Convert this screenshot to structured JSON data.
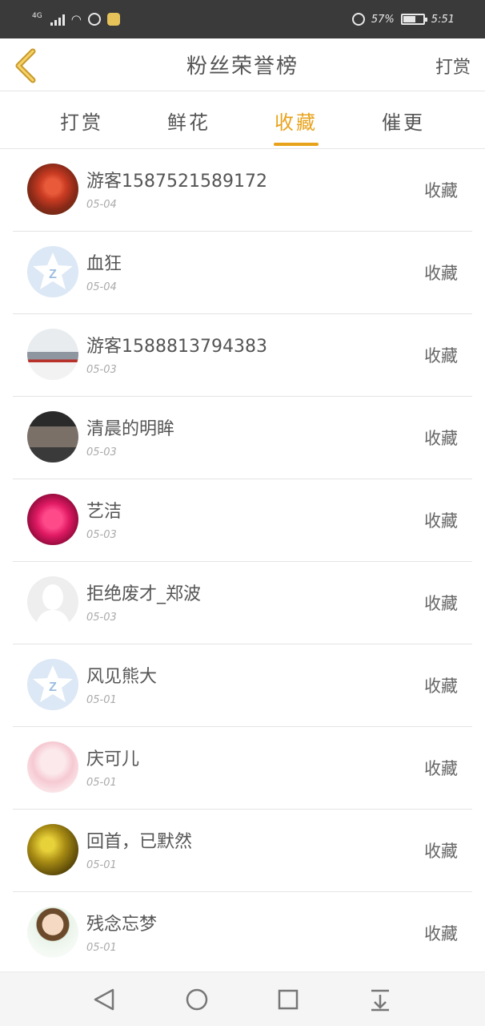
{
  "status": {
    "network": "4G",
    "battery_text": "57%",
    "battery_level": 0.57,
    "time": "5:51"
  },
  "header": {
    "title": "粉丝荣誉榜",
    "action": "打赏"
  },
  "tabs": [
    {
      "label": "打赏",
      "active": false
    },
    {
      "label": "鲜花",
      "active": false
    },
    {
      "label": "收藏",
      "active": true
    },
    {
      "label": "催更",
      "active": false
    }
  ],
  "accent_color": "#e8a31c",
  "fans": [
    {
      "name": "游客1587521589172",
      "date": "05-04",
      "action": "收藏",
      "avatar": "red-flower"
    },
    {
      "name": "血狂",
      "date": "05-04",
      "action": "收藏",
      "avatar": "qq-default"
    },
    {
      "name": "游客1588813794383",
      "date": "05-03",
      "action": "收藏",
      "avatar": "warship"
    },
    {
      "name": "清晨的明眸",
      "date": "05-03",
      "action": "收藏",
      "avatar": "building"
    },
    {
      "name": "艺洁",
      "date": "05-03",
      "action": "收藏",
      "avatar": "pink-rose"
    },
    {
      "name": "拒绝废才_郑波",
      "date": "05-03",
      "action": "收藏",
      "avatar": "blank-person"
    },
    {
      "name": "风见熊大",
      "date": "05-01",
      "action": "收藏",
      "avatar": "qq-default"
    },
    {
      "name": "庆可儿",
      "date": "05-01",
      "action": "收藏",
      "avatar": "anime-girl"
    },
    {
      "name": "回首，已默然",
      "date": "05-01",
      "action": "收藏",
      "avatar": "golden-lights"
    },
    {
      "name": "残念忘梦",
      "date": "05-01",
      "action": "收藏",
      "avatar": "cartoon-boy"
    }
  ],
  "navbar": [
    "back-triangle-icon",
    "home-circle-icon",
    "recents-square-icon",
    "notification-pull-icon"
  ]
}
